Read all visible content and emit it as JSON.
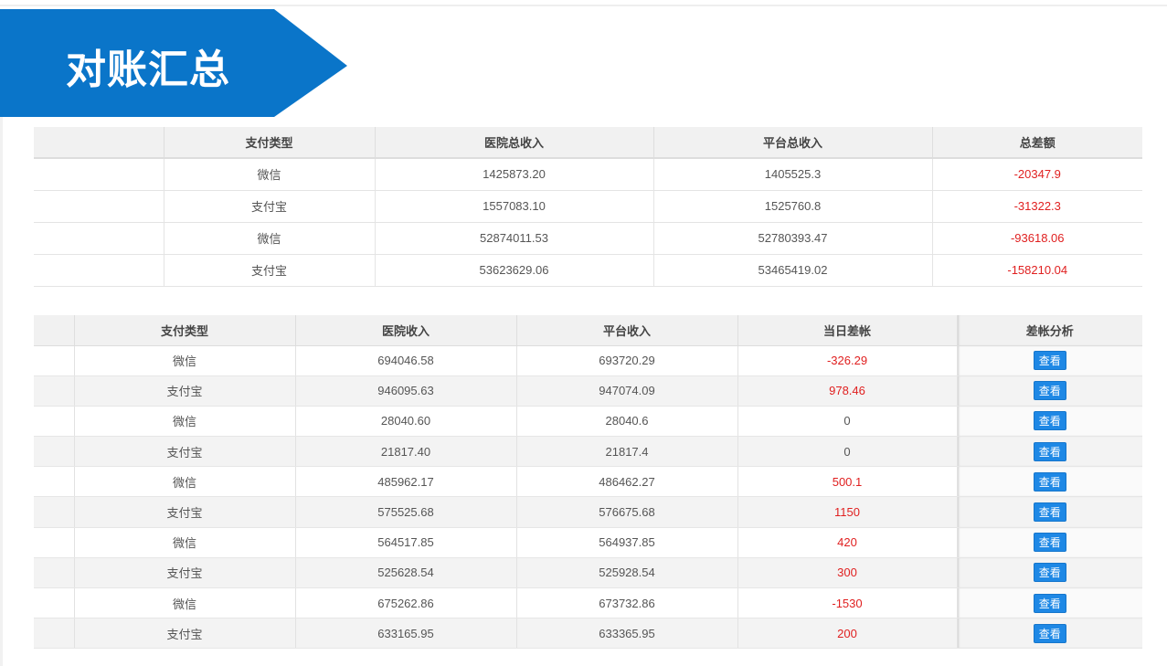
{
  "page": {
    "title": "对账汇总",
    "accent": "#0A75C9"
  },
  "summary": {
    "headers": [
      "",
      "支付类型",
      "医院总收入",
      "平台总收入",
      "总差额"
    ],
    "rows": [
      {
        "type": "微信",
        "hospital": "1425873.20",
        "platform": "1405525.3",
        "diff": "-20347.9"
      },
      {
        "type": "支付宝",
        "hospital": "1557083.10",
        "platform": "1525760.8",
        "diff": "-31322.3"
      },
      {
        "type": "微信",
        "hospital": "52874011.53",
        "platform": "52780393.47",
        "diff": "-93618.06"
      },
      {
        "type": "支付宝",
        "hospital": "53623629.06",
        "platform": "53465419.02",
        "diff": "-158210.04"
      }
    ]
  },
  "detail": {
    "headers": [
      "",
      "支付类型",
      "医院收入",
      "平台收入",
      "当日差帐",
      "差帐分析"
    ],
    "view_label": "查看",
    "rows": [
      {
        "type": "微信",
        "hospital": "694046.58",
        "platform": "693720.29",
        "diff": "-326.29"
      },
      {
        "type": "支付宝",
        "hospital": "946095.63",
        "platform": "947074.09",
        "diff": "978.46"
      },
      {
        "type": "微信",
        "hospital": "28040.60",
        "platform": "28040.6",
        "diff": "0"
      },
      {
        "type": "支付宝",
        "hospital": "21817.40",
        "platform": "21817.4",
        "diff": "0"
      },
      {
        "type": "微信",
        "hospital": "485962.17",
        "platform": "486462.27",
        "diff": "500.1"
      },
      {
        "type": "支付宝",
        "hospital": "575525.68",
        "platform": "576675.68",
        "diff": "1150"
      },
      {
        "type": "微信",
        "hospital": "564517.85",
        "platform": "564937.85",
        "diff": "420"
      },
      {
        "type": "支付宝",
        "hospital": "525628.54",
        "platform": "525928.54",
        "diff": "300"
      },
      {
        "type": "微信",
        "hospital": "675262.86",
        "platform": "673732.86",
        "diff": "-1530"
      },
      {
        "type": "支付宝",
        "hospital": "633165.95",
        "platform": "633365.95",
        "diff": "200"
      }
    ]
  }
}
